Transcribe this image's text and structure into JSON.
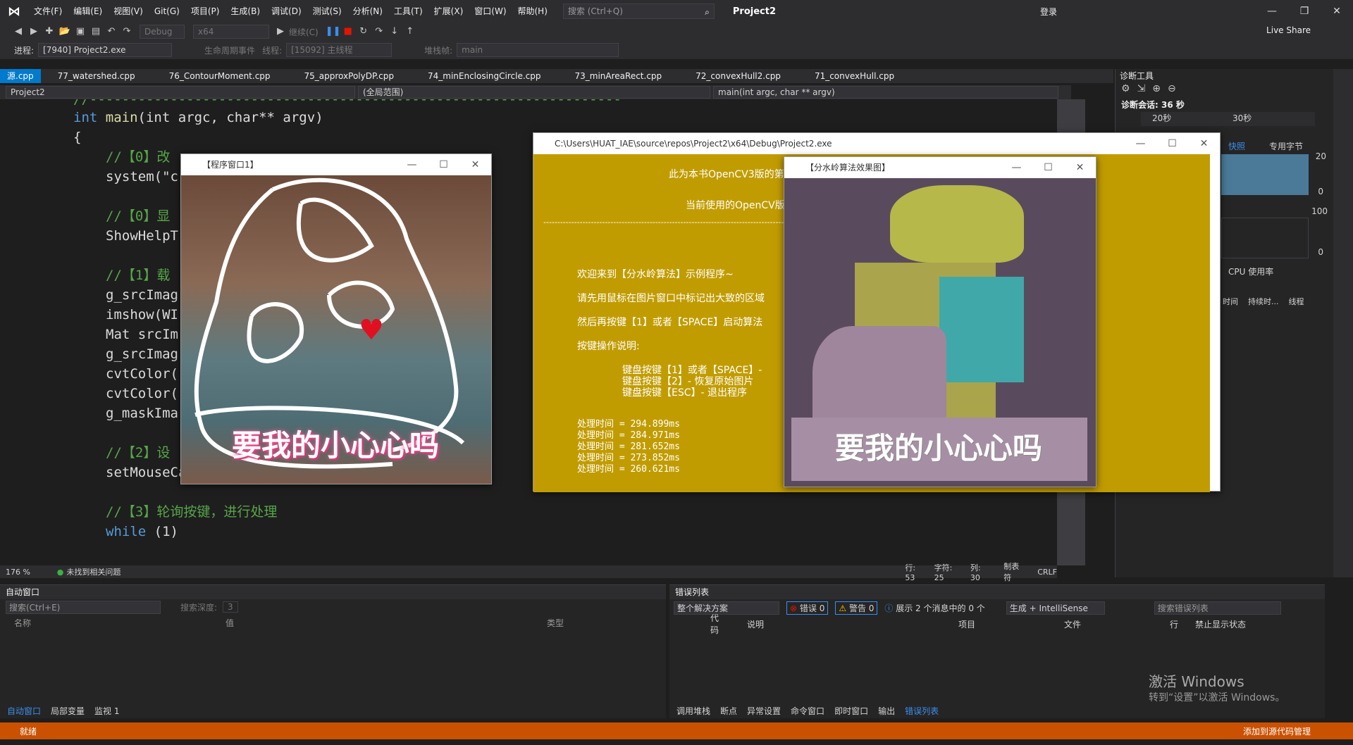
{
  "menubar": {
    "items": [
      "文件(F)",
      "编辑(E)",
      "视图(V)",
      "Git(G)",
      "项目(P)",
      "生成(B)",
      "调试(D)",
      "测试(S)",
      "分析(N)",
      "工具(T)",
      "扩展(X)",
      "窗口(W)",
      "帮助(H)"
    ],
    "search_placeholder": "搜索 (Ctrl+Q)",
    "project_title": "Project2",
    "login": "登录"
  },
  "toolbar": {
    "config": "Debug",
    "platform": "x64",
    "continue_label": "继续(C)",
    "live_share": "Live Share"
  },
  "toolbar2": {
    "process_label": "进程:",
    "process_value": "[7940] Project2.exe",
    "lifecycle_label": "生命周期事件",
    "thread_label": "线程:",
    "thread_value": "[15092] 主线程",
    "stack_label": "堆栈帧:",
    "stack_value": "main"
  },
  "tabs": [
    "源.cpp",
    "77_watershed.cpp",
    "76_ContourMoment.cpp",
    "75_approxPolyDP.cpp",
    "74_minEnclosingCircle.cpp",
    "73_minAreaRect.cpp",
    "72_convexHull2.cpp",
    "71_convexHull.cpp"
  ],
  "navbar": {
    "project": "Project2",
    "scope": "(全局范围)",
    "function": "main(int argc, char ** argv)"
  },
  "code": {
    "l1": "//------------------------------------------------------------------",
    "l2_kw": "int",
    "l2_fn": " main",
    "l2_rest": "(int argc, char** argv)",
    "l3": "{",
    "l4": "//【0】改",
    "l5": "system(\"c",
    "l6": "//【0】显",
    "l7": "ShowHelpT",
    "l8": "//【1】载",
    "l9": "g_srcImag",
    "l10": "imshow(WI",
    "l11": "Mat srcIm",
    "l12": "g_srcImag",
    "l13": "cvtColor(",
    "l14": "cvtColor(",
    "l15": "g_maskIma",
    "l16": "//【2】设",
    "l17": "setMouseCallback(WINDOW_NAME1, on_Mouse, 0);",
    "l18": "//【3】轮询按键，进行处理",
    "l19_kw": "while",
    "l19_rest": " (1)"
  },
  "editor_status": {
    "zoom": "176 %",
    "issues": "未找到相关问题",
    "line": "行: 53",
    "char": "字符: 25",
    "col": "列: 30",
    "tabs": "制表符",
    "eol": "CRLF"
  },
  "diagnostics": {
    "title": "诊断工具",
    "session": "诊断会话: 36 秒",
    "t20": "20秒",
    "t30": "30秒",
    "snapshot": "快照",
    "bytes": "专用字节",
    "v20": "20",
    "v0": "0",
    "v100": "100",
    "cpu": "CPU 使用率",
    "col_time": "时间",
    "col_duration": "持续时...",
    "col_thread": "线程"
  },
  "window1": {
    "title": "【程序窗口1】",
    "caption": "要我的小心心吗"
  },
  "console": {
    "title": "C:\\Users\\HUAT_IAE\\source\\repos\\Project2\\x64\\Debug\\Project2.exe",
    "line1": "此为本书OpenCV3版的第",
    "line2": "当前使用的OpenCV版",
    "divider": "------------------------------------------------------------------------------------------------",
    "welcome": "欢迎来到【分水岭算法】示例程序~",
    "instr1": "请先用鼠标在图片窗口中标记出大致的区域",
    "instr2": "然后再按键【1】或者【SPACE】启动算法",
    "ops": "按键操作说明:",
    "k1": "键盘按键【1】或者【SPACE】- ",
    "k2": "键盘按键【2】- 恢复原始图片",
    "k3": "键盘按键【ESC】- 退出程序",
    "t1": "处理时间 = 294.899ms",
    "t2": "处理时间 = 284.971ms",
    "t3": "处理时间 = 281.652ms",
    "t4": "处理时间 = 273.852ms",
    "t5": "处理时间 = 260.621ms"
  },
  "window2": {
    "title": "【分水岭算法效果图】",
    "caption": "要我的小心心吗"
  },
  "autos": {
    "title": "自动窗口",
    "search": "搜索(Ctrl+E)",
    "depth_label": "搜索深度:",
    "depth": "3",
    "col_name": "名称",
    "col_value": "值",
    "col_type": "类型",
    "tabs": [
      "自动窗口",
      "局部变量",
      "监视 1"
    ]
  },
  "errors": {
    "title": "错误列表",
    "scope": "整个解决方案",
    "errors": "错误 0",
    "warnings": "警告 0",
    "messages": "展示 2 个消息中的 0 个",
    "build": "生成 + IntelliSense",
    "search": "搜索错误列表",
    "col_code": "代码",
    "col_desc": "说明",
    "col_project": "项目",
    "col_file": "文件",
    "col_line": "行",
    "col_suppress": "禁止显示状态",
    "tabs": [
      "调用堆栈",
      "断点",
      "异常设置",
      "命令窗口",
      "即时窗口",
      "输出",
      "错误列表"
    ]
  },
  "watermark": {
    "line1": "激活 Windows",
    "line2": "转到“设置”以激活 Windows。"
  },
  "statusbar": {
    "ready": "就绪",
    "source_control": "添加到源代码管理"
  },
  "colors": {
    "accent": "#007acc",
    "status": "#ca5100",
    "console_bg": "#c19c00"
  }
}
